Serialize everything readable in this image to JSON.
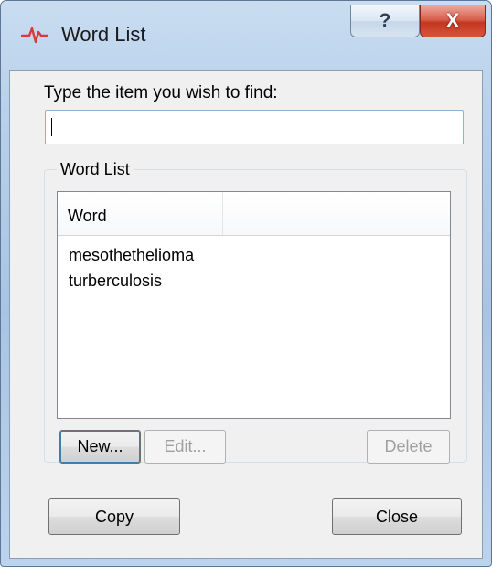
{
  "window": {
    "title": "Word List",
    "help_glyph": "?",
    "close_glyph": "X"
  },
  "search": {
    "prompt": "Type the item you wish to find:",
    "value": ""
  },
  "group": {
    "label": "Word List"
  },
  "list": {
    "columns": [
      "Word",
      ""
    ],
    "rows": [
      "mesothethelioma",
      "turberculosis"
    ]
  },
  "buttons": {
    "new": "New...",
    "edit": "Edit...",
    "delete": "Delete",
    "copy": "Copy",
    "close": "Close"
  },
  "icons": {
    "app": "heartbeat-icon"
  },
  "colors": {
    "app_icon": "#d93a3a",
    "close_button": "#c9422c",
    "focus_border": "#3c7fb1"
  }
}
